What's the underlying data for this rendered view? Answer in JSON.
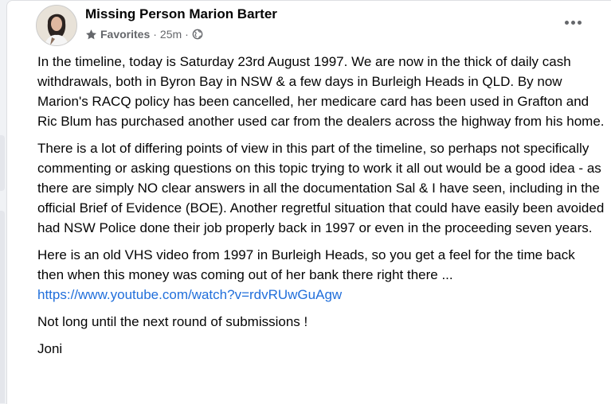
{
  "post": {
    "author": "Missing Person Marion Barter",
    "audience": "Favorites",
    "time": "25m",
    "separator": "·",
    "icons": {
      "audience": "star-icon",
      "privacy": "globe-icon",
      "menu": "more-options-icon"
    },
    "paragraphs": [
      "In the timeline, today is Saturday 23rd August 1997. We are now in the thick of daily cash withdrawals, both in Byron Bay in NSW & a few days in Burleigh Heads in QLD. By now Marion's RACQ policy has been cancelled, her medicare card has been used in Grafton and Ric Blum has purchased another used car from the dealers across the highway from his home.",
      "There is a lot of differing points of view in this part of the timeline, so perhaps not specifically commenting or asking questions on this topic trying to work it all out would be a good idea - as there are simply NO clear answers in all the documentation Sal & I have seen, including in the official Brief of Evidence (BOE). Another regretful situation that could have easily been avoided had NSW Police done their job properly back in 1997 or even in the proceeding seven years.",
      "Here is an old VHS video from 1997 in Burleigh Heads, so you get a feel for the time back then when this money was coming out of her bank there right there ...",
      "Not long until the next round of submissions !",
      "Joni"
    ],
    "link": "https://www.youtube.com/watch?v=rdvRUwGuAgw",
    "colors": {
      "link": "#216fdb",
      "text": "#050505",
      "meta": "#65676b"
    }
  }
}
